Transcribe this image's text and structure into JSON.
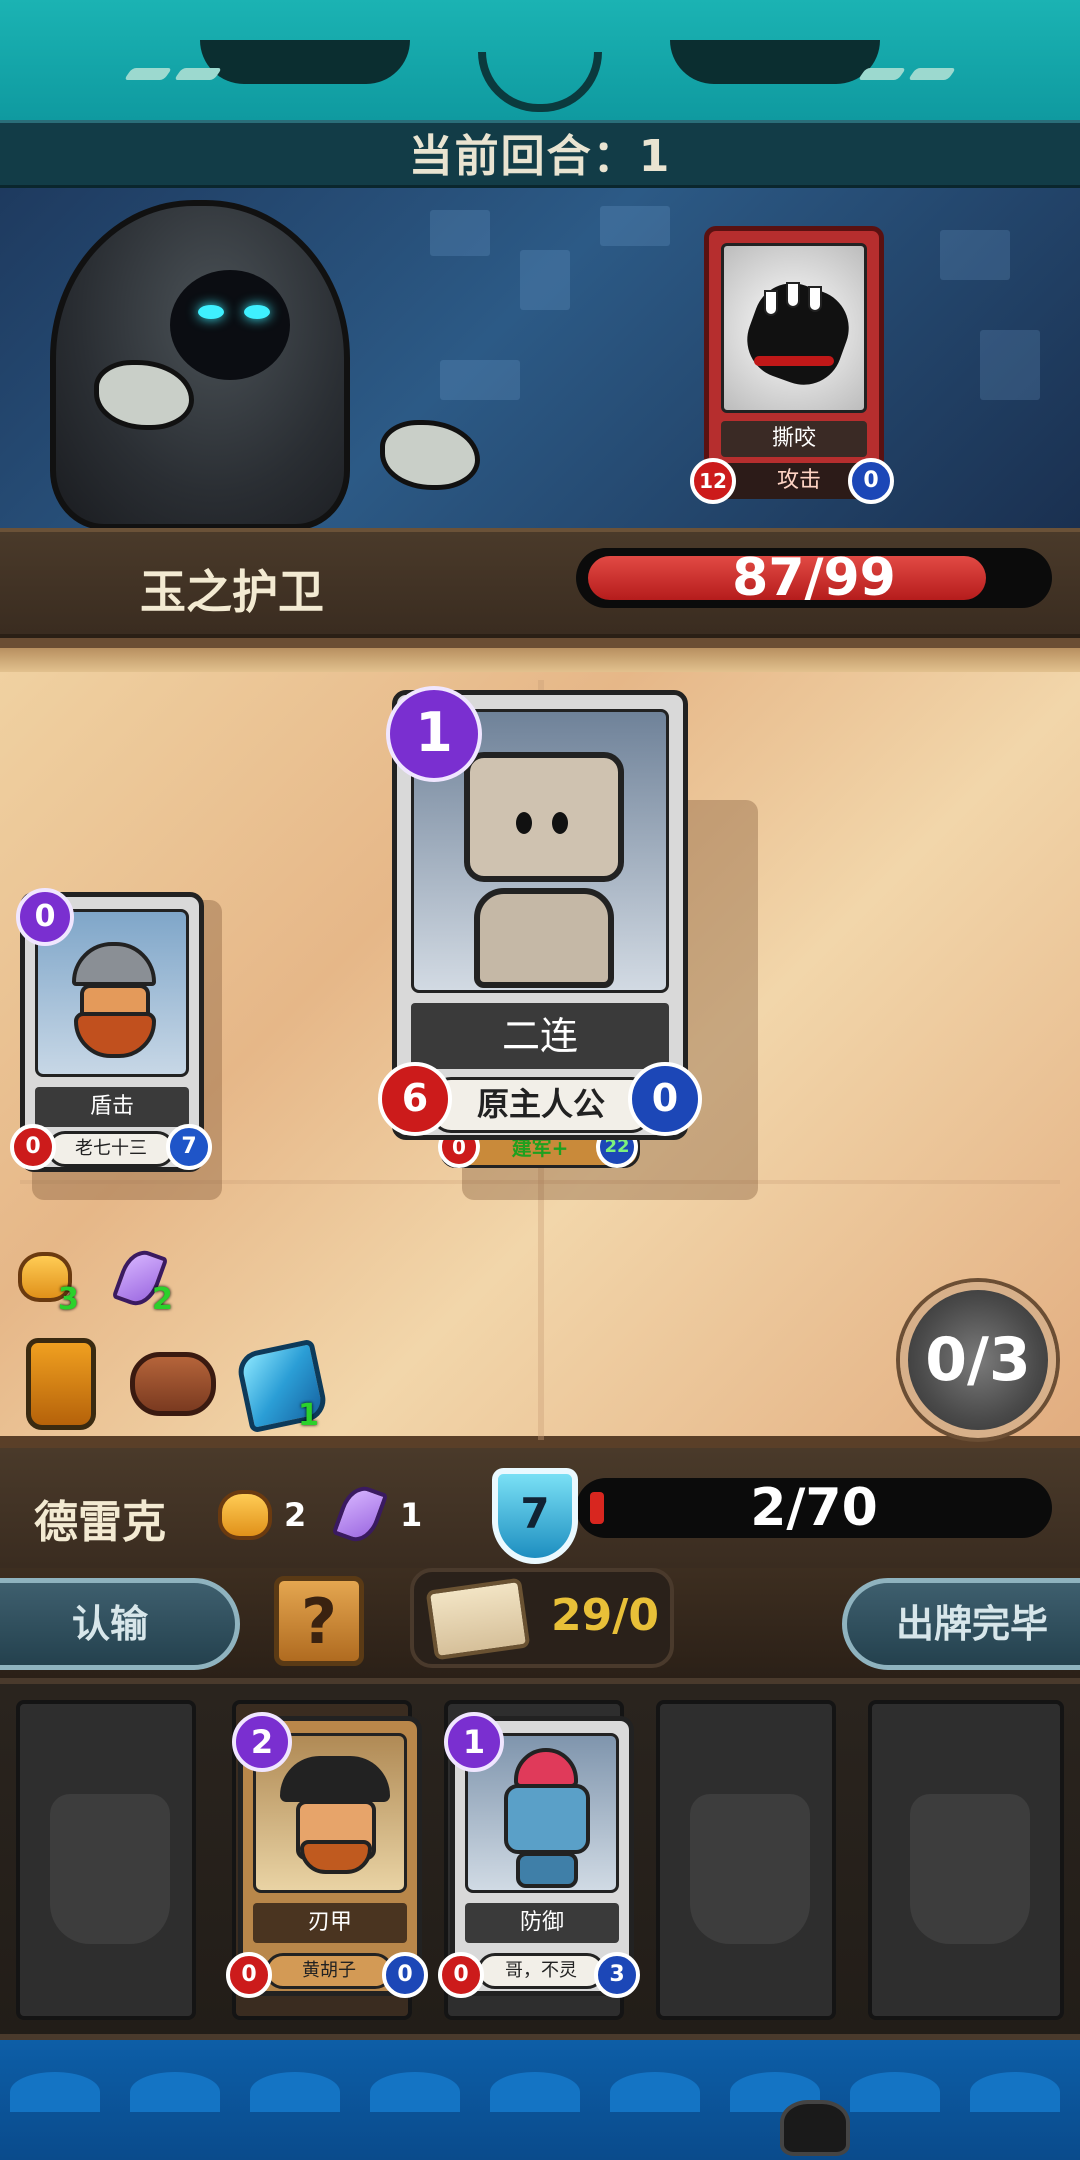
{
  "round": {
    "label": "当前回合：",
    "value": "1"
  },
  "enemy": {
    "name": "玉之护卫",
    "hp": "87/99",
    "hp_fraction": 0.88,
    "intent_card": {
      "name": "撕咬",
      "type": "攻击",
      "attack": "12",
      "shield": "0"
    }
  },
  "board_cards": [
    {
      "cost": "0",
      "name": "盾击",
      "owner": "老七十三",
      "attack": "0",
      "shield": "7"
    },
    {
      "cost": "1",
      "name": "二连",
      "owner": "原主人公",
      "attack": "6",
      "shield": "0",
      "under_owner": "建军+",
      "under_attack": "0",
      "under_shield": "22"
    }
  ],
  "buffs": [
    {
      "icon": "fist-icon",
      "value": "3"
    },
    {
      "icon": "crystal-shard-icon",
      "value": "2"
    }
  ],
  "relics": [
    {
      "icon": "potion-icon",
      "value": ""
    },
    {
      "icon": "belt-icon",
      "value": ""
    },
    {
      "icon": "gem-icon",
      "value": "1"
    }
  ],
  "actions": "0/3",
  "player": {
    "name": "德雷克",
    "strength": "2",
    "armor": "1",
    "shield": "7",
    "hp": "2/70",
    "hp_fraction": 0.03
  },
  "controls": {
    "surrender": "认输",
    "help": "?",
    "deck_count": "29/0",
    "end_turn": "出牌完毕"
  },
  "hand": [
    {
      "empty": true
    },
    {
      "cost": "2",
      "name": "刃甲",
      "owner": "黄胡子",
      "attack": "0",
      "shield": "0"
    },
    {
      "cost": "1",
      "name": "防御",
      "owner": "哥，不灵",
      "attack": "0",
      "shield": "3"
    },
    {
      "empty": true
    },
    {
      "empty": true
    }
  ],
  "colors": {
    "attack": "#cc1b1b",
    "shield": "#1c47b7",
    "cost": "#7a2fd0",
    "accent_teal": "#1bb3b3",
    "gold": "#e8c038"
  }
}
